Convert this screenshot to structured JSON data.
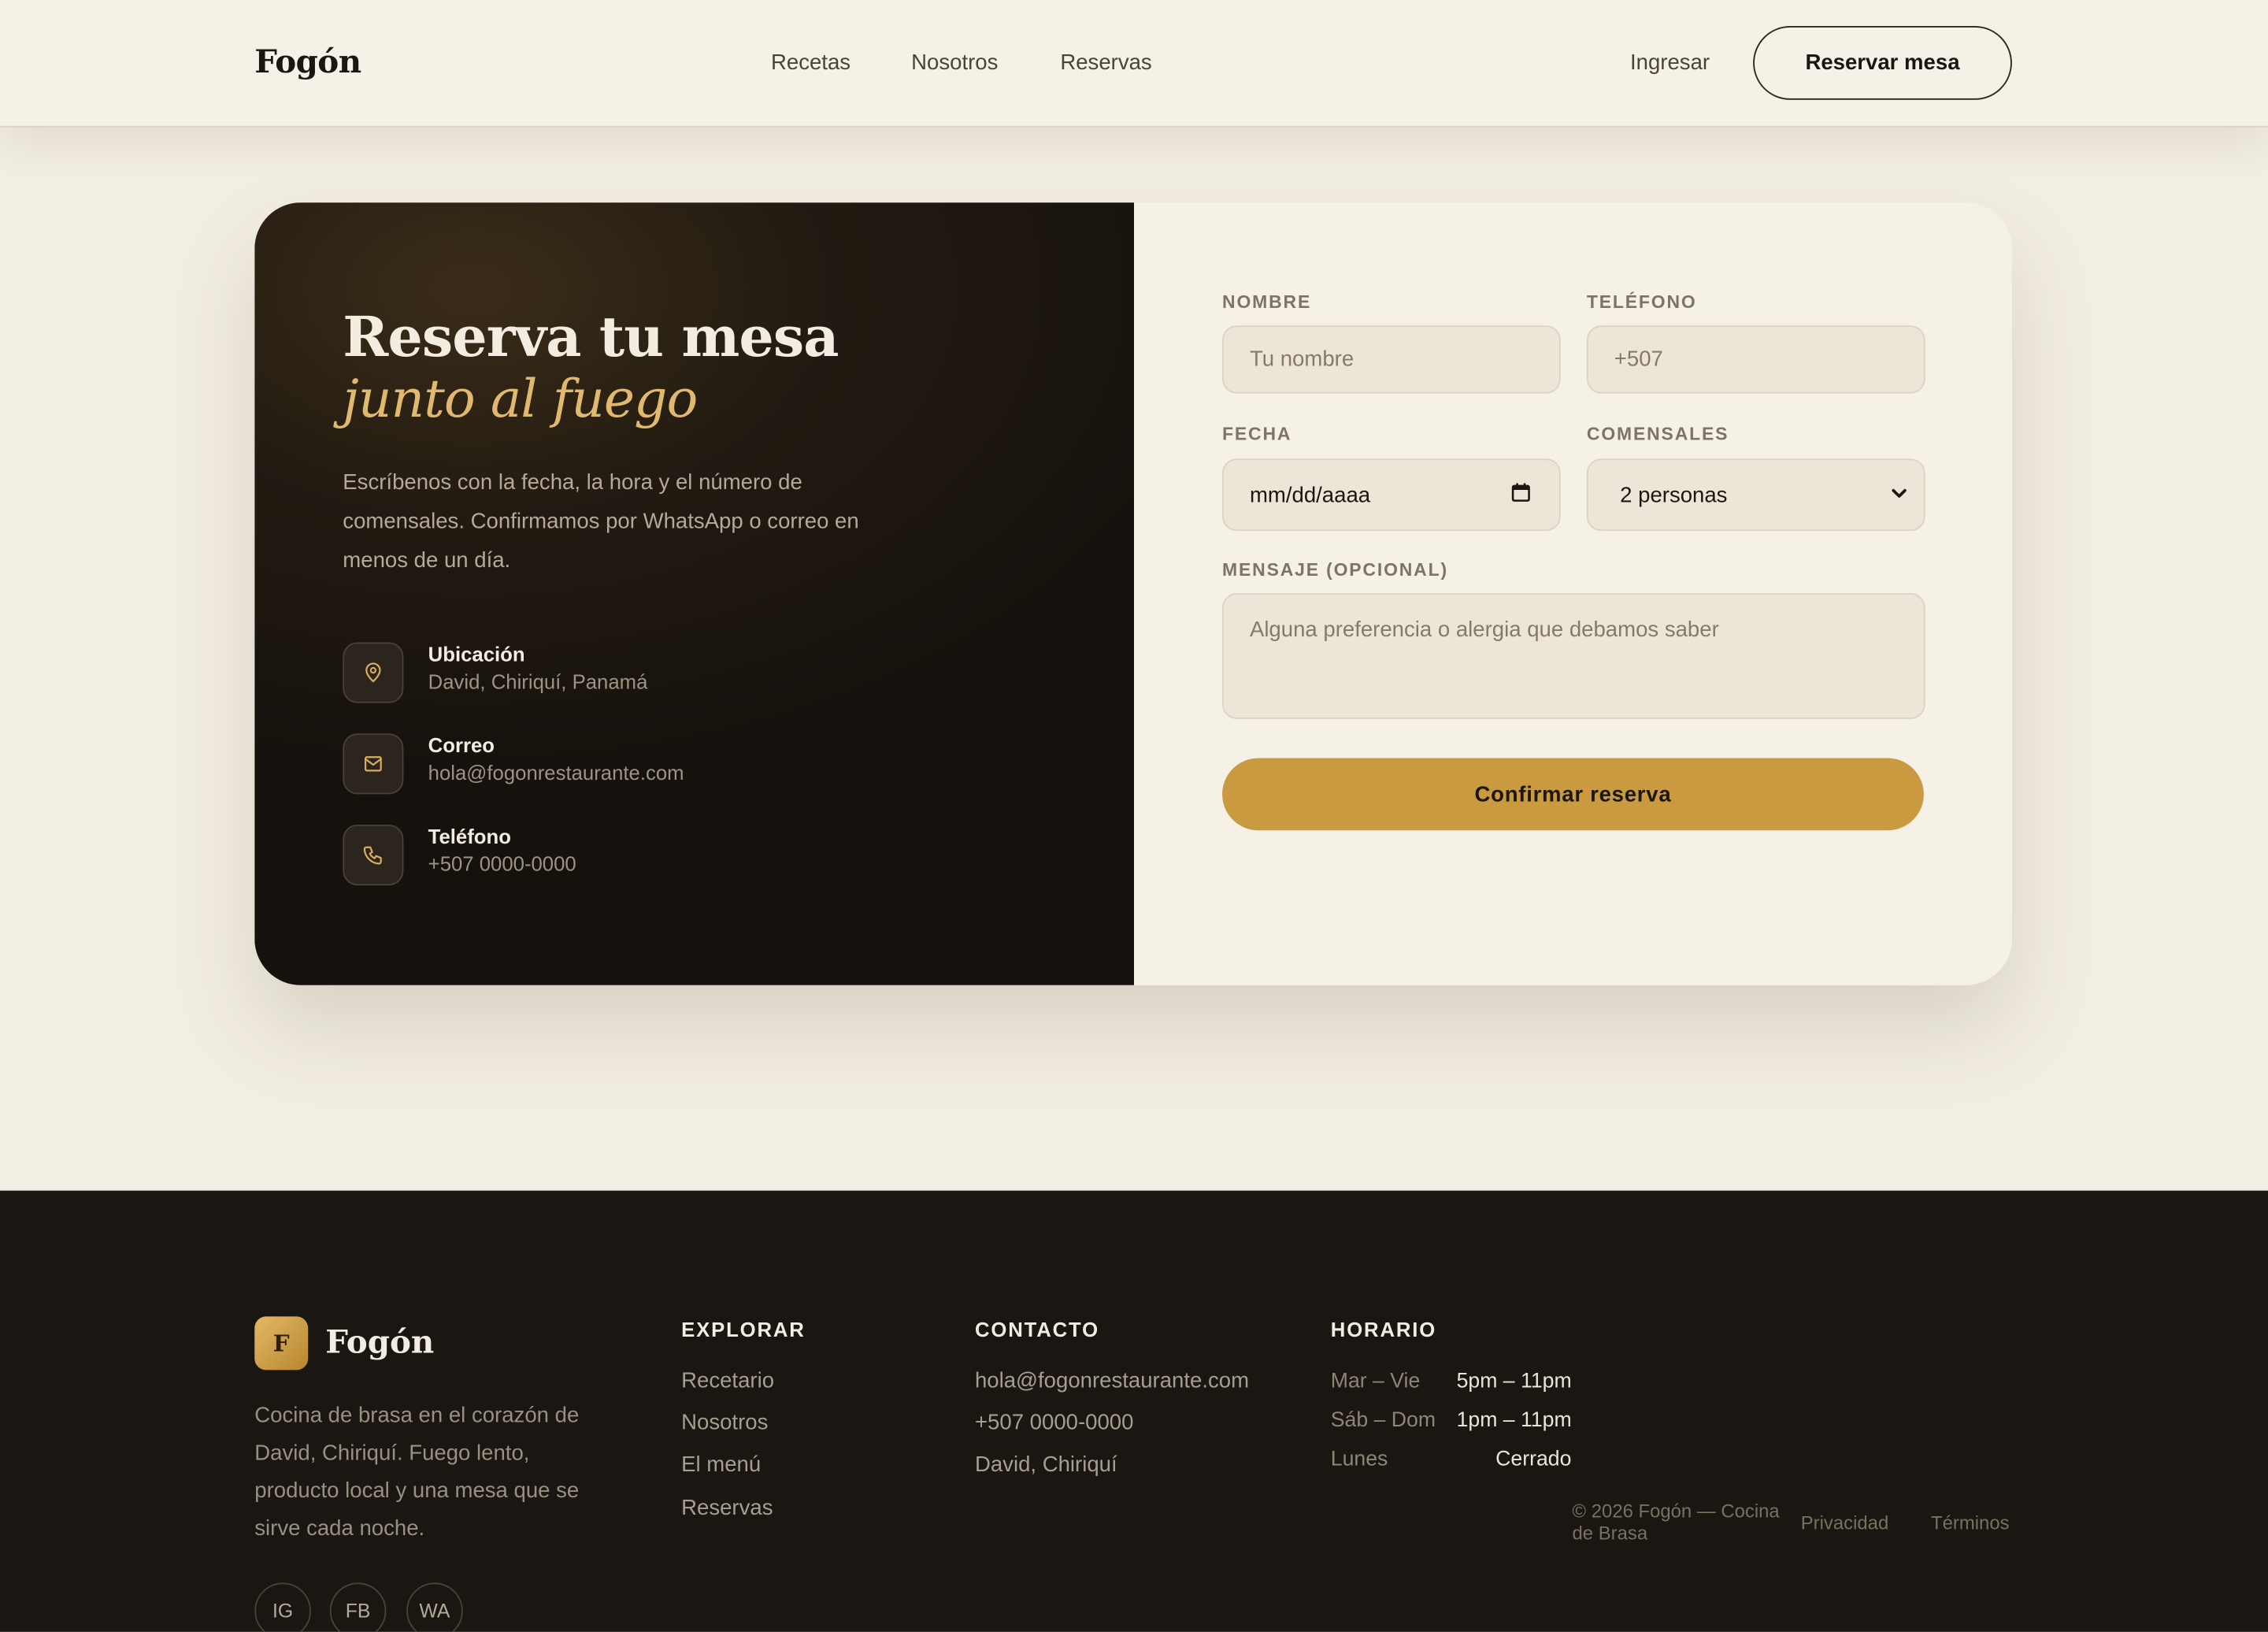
{
  "header": {
    "brand": "Fogón",
    "nav": [
      "Recetas",
      "Nosotros",
      "Reservas"
    ],
    "login": "Ingresar",
    "cta": "Reservar mesa"
  },
  "hero": {
    "title_line1": "Reserva tu mesa",
    "title_line2": "junto al fuego",
    "description": "Escríbenos con la fecha, la hora y el número de comensales. Confirmamos por WhatsApp o correo en menos de un día.",
    "info": [
      {
        "icon": "location-pin-icon",
        "label": "Ubicación",
        "value": "David, Chiriquí, Panamá"
      },
      {
        "icon": "mail-icon",
        "label": "Correo",
        "value": "hola@fogonrestaurante.com"
      },
      {
        "icon": "phone-icon",
        "label": "Teléfono",
        "value": "+507 0000-0000"
      }
    ]
  },
  "form": {
    "name_label": "NOMBRE",
    "name_placeholder": "Tu nombre",
    "phone_label": "TELÉFONO",
    "phone_placeholder": "+507",
    "date_label": "FECHA",
    "date_placeholder": "mm/dd/aaaa",
    "guests_label": "COMENSALES",
    "guests_value": "2 personas",
    "message_label": "MENSAJE (OPCIONAL)",
    "message_placeholder": "Alguna preferencia o alergia que debamos saber",
    "submit": "Confirmar reserva"
  },
  "footer": {
    "logo_letter": "F",
    "brand": "Fogón",
    "description": "Cocina de brasa en el corazón de David, Chiriquí. Fuego lento, producto local y una mesa que se sirve cada noche.",
    "social": [
      "IG",
      "FB",
      "WA"
    ],
    "explore_heading": "EXPLORAR",
    "explore": [
      "Recetario",
      "Nosotros",
      "El menú",
      "Reservas"
    ],
    "contact_heading": "CONTACTO",
    "contact": [
      "hola@fogonrestaurante.com",
      "+507 0000-0000",
      "David, Chiriquí"
    ],
    "hours_heading": "HORARIO",
    "hours": [
      {
        "day": "Mar – Vie",
        "time": "5pm – 11pm"
      },
      {
        "day": "Sáb – Dom",
        "time": "1pm – 11pm"
      },
      {
        "day": "Lunes",
        "time": "Cerrado"
      }
    ],
    "copyright": "© 2026 Fogón — Cocina de Brasa",
    "privacy": "Privacidad",
    "terms": "Términos"
  },
  "colors": {
    "accent": "#c99a40",
    "accent_text": "#e0b86e",
    "background": "#f3eee4",
    "dark": "#1a1612"
  }
}
